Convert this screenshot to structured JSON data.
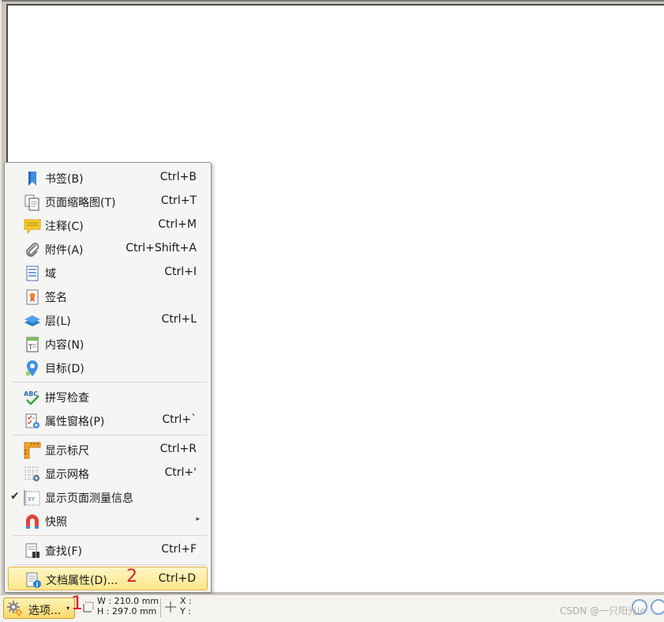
{
  "menu": {
    "items": [
      {
        "label": "书签(B)",
        "shortcut": "Ctrl+B"
      },
      {
        "label": "页面缩略图(T)",
        "shortcut": "Ctrl+T"
      },
      {
        "label": "注释(C)",
        "shortcut": "Ctrl+M"
      },
      {
        "label": "附件(A)",
        "shortcut": "Ctrl+Shift+A"
      },
      {
        "label": "域",
        "shortcut": "Ctrl+I"
      },
      {
        "label": "签名",
        "shortcut": ""
      },
      {
        "label": "层(L)",
        "shortcut": "Ctrl+L"
      },
      {
        "label": "内容(N)",
        "shortcut": ""
      },
      {
        "label": "目标(D)",
        "shortcut": ""
      },
      {
        "label": "拼写检查",
        "shortcut": ""
      },
      {
        "label": "属性窗格(P)",
        "shortcut": "Ctrl+`"
      },
      {
        "label": "显示标尺",
        "shortcut": "Ctrl+R"
      },
      {
        "label": "显示网格",
        "shortcut": "Ctrl+'"
      },
      {
        "label": "显示页面测量信息",
        "shortcut": "",
        "checked": true,
        "check_mark": "✔"
      },
      {
        "label": "快照",
        "shortcut": "",
        "submenu_arrow": "▸"
      },
      {
        "label": "查找(F)",
        "shortcut": "Ctrl+F"
      },
      {
        "label": "文档属性(D)...",
        "shortcut": "Ctrl+D",
        "highlighted": true
      }
    ]
  },
  "annotations": {
    "step1": "1",
    "step2": "2"
  },
  "statusbar": {
    "options_label": "选项...",
    "dropdown_glyph": "▾",
    "width_label": "W : 210.0 mm",
    "height_label": "H : 297.0 mm",
    "x_label": "X :",
    "y_label": "Y :",
    "watermark": "CSDN @一只阳光le"
  },
  "colors": {
    "highlight_top": "#fff6c4",
    "highlight_bottom": "#fde68a",
    "annotation_red": "#e02020",
    "bookmark_blue": "#3d8fe0"
  }
}
